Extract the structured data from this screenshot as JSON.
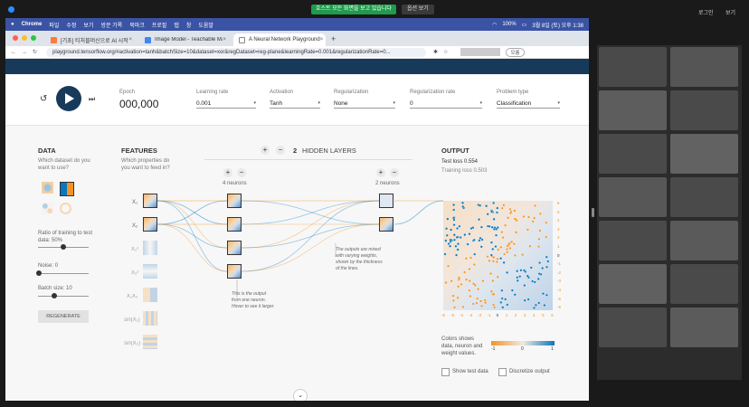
{
  "zoom": {
    "share_banner": "호스트 모든 화면을 보고 있습니다",
    "view_options": "옵션 보기",
    "recording": "로그인",
    "gallery": "보기"
  },
  "menubar": {
    "app": "Chrome",
    "items": [
      "파일",
      "수정",
      "보기",
      "방문 기록",
      "북마크",
      "프로필",
      "탭",
      "창",
      "도움말"
    ],
    "battery": "100%",
    "clock": "3월 8일 (토) 오후 1:38"
  },
  "tabs": [
    {
      "label": "[기초] 티처블머신으로 AI 시작하기 - ...",
      "active": false
    },
    {
      "label": "Image Model - Teachable Machine",
      "active": false
    },
    {
      "label": "A Neural Network Playground",
      "active": true
    }
  ],
  "address": {
    "url": "playground.tensorflow.org/#activation=tanh&batchSize=10&dataset=xor&regDataset=reg-plane&learningRate=0.001&regularizationRate=0...",
    "profile_btn": "모롱"
  },
  "controls": {
    "epoch_label": "Epoch",
    "epoch_value": "000,000",
    "learning_rate_label": "Learning rate",
    "learning_rate_value": "0.001",
    "activation_label": "Activation",
    "activation_value": "Tanh",
    "regularization_label": "Regularization",
    "regularization_value": "None",
    "reg_rate_label": "Regularization rate",
    "reg_rate_value": "0",
    "problem_label": "Problem type",
    "problem_value": "Classification"
  },
  "data_panel": {
    "title": "DATA",
    "subtitle": "Which dataset do you want to use?",
    "ratio_label": "Ratio of training to test data:",
    "ratio_value": "50%",
    "noise_label": "Noise:",
    "noise_value": "0",
    "batch_label": "Batch size:",
    "batch_value": "10",
    "regenerate": "REGENERATE"
  },
  "features": {
    "title": "FEATURES",
    "subtitle": "Which properties do you want to feed in?",
    "labels": [
      "X₁",
      "X₂",
      "X₁²",
      "X₂²",
      "X₁X₂",
      "sin(X₁)",
      "sin(X₂)"
    ]
  },
  "hidden": {
    "count": "2",
    "title": "HIDDEN LAYERS",
    "layer1_neurons": "4 neurons",
    "layer2_neurons": "2 neurons"
  },
  "notes": {
    "neuron_note": "This is the output from one neuron. Hover to see it larger.",
    "weights_note": "The outputs are mixed with varying weights, shown by the thickness of the lines."
  },
  "output": {
    "title": "OUTPUT",
    "test_loss": "Test loss 0.554",
    "training_loss": "Training loss 0.503",
    "legend_text": "Colors shows data, neuron and weight values.",
    "legend_min": "-1",
    "legend_mid": "0",
    "legend_max": "1",
    "show_test": "Show test data",
    "discretize": "Discretize output",
    "x_ticks": [
      "-6",
      "-5",
      "-4",
      "-3",
      "-2",
      "-1",
      "0",
      "1",
      "2",
      "3",
      "4",
      "5",
      "6"
    ],
    "y_ticks": [
      "6",
      "5",
      "4",
      "3",
      "2",
      "1",
      "0",
      "-1",
      "-2",
      "-3",
      "-4",
      "-5",
      "-6"
    ]
  },
  "colors": {
    "orange": "#f59322",
    "blue": "#0877bd",
    "accent": "#183a5a"
  }
}
